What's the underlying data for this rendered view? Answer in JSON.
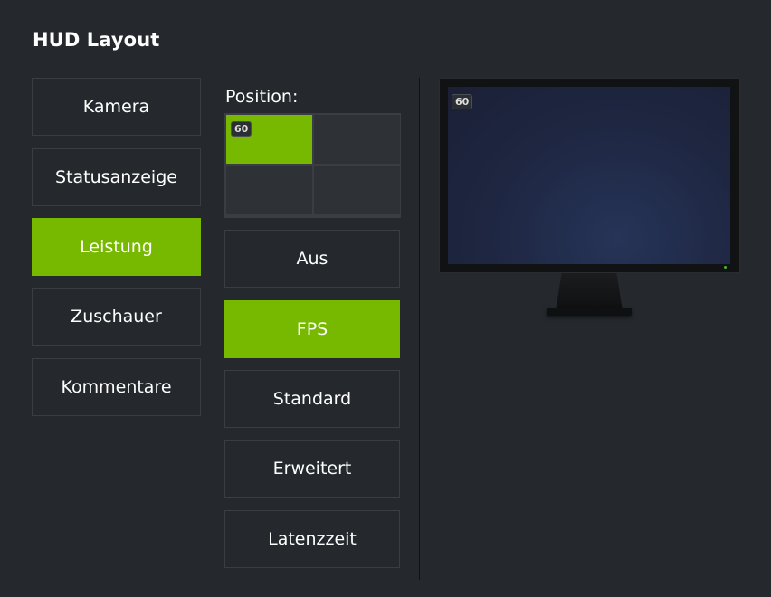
{
  "title": "HUD Layout",
  "categories": [
    {
      "label": "Kamera",
      "active": false
    },
    {
      "label": "Statusanzeige",
      "active": false
    },
    {
      "label": "Leistung",
      "active": true
    },
    {
      "label": "Zuschauer",
      "active": false
    },
    {
      "label": "Kommentare",
      "active": false
    }
  ],
  "position": {
    "label": "Position:",
    "selected": "top-left",
    "badge": "60"
  },
  "options": [
    {
      "label": "Aus",
      "active": false
    },
    {
      "label": "FPS",
      "active": true
    },
    {
      "label": "Standard",
      "active": false
    },
    {
      "label": "Erweitert",
      "active": false
    },
    {
      "label": "Latenzzeit",
      "active": false
    }
  ],
  "preview": {
    "badge": "60"
  },
  "colors": {
    "accent": "#76b900",
    "background": "#25292d",
    "border": "#3a3e43"
  }
}
